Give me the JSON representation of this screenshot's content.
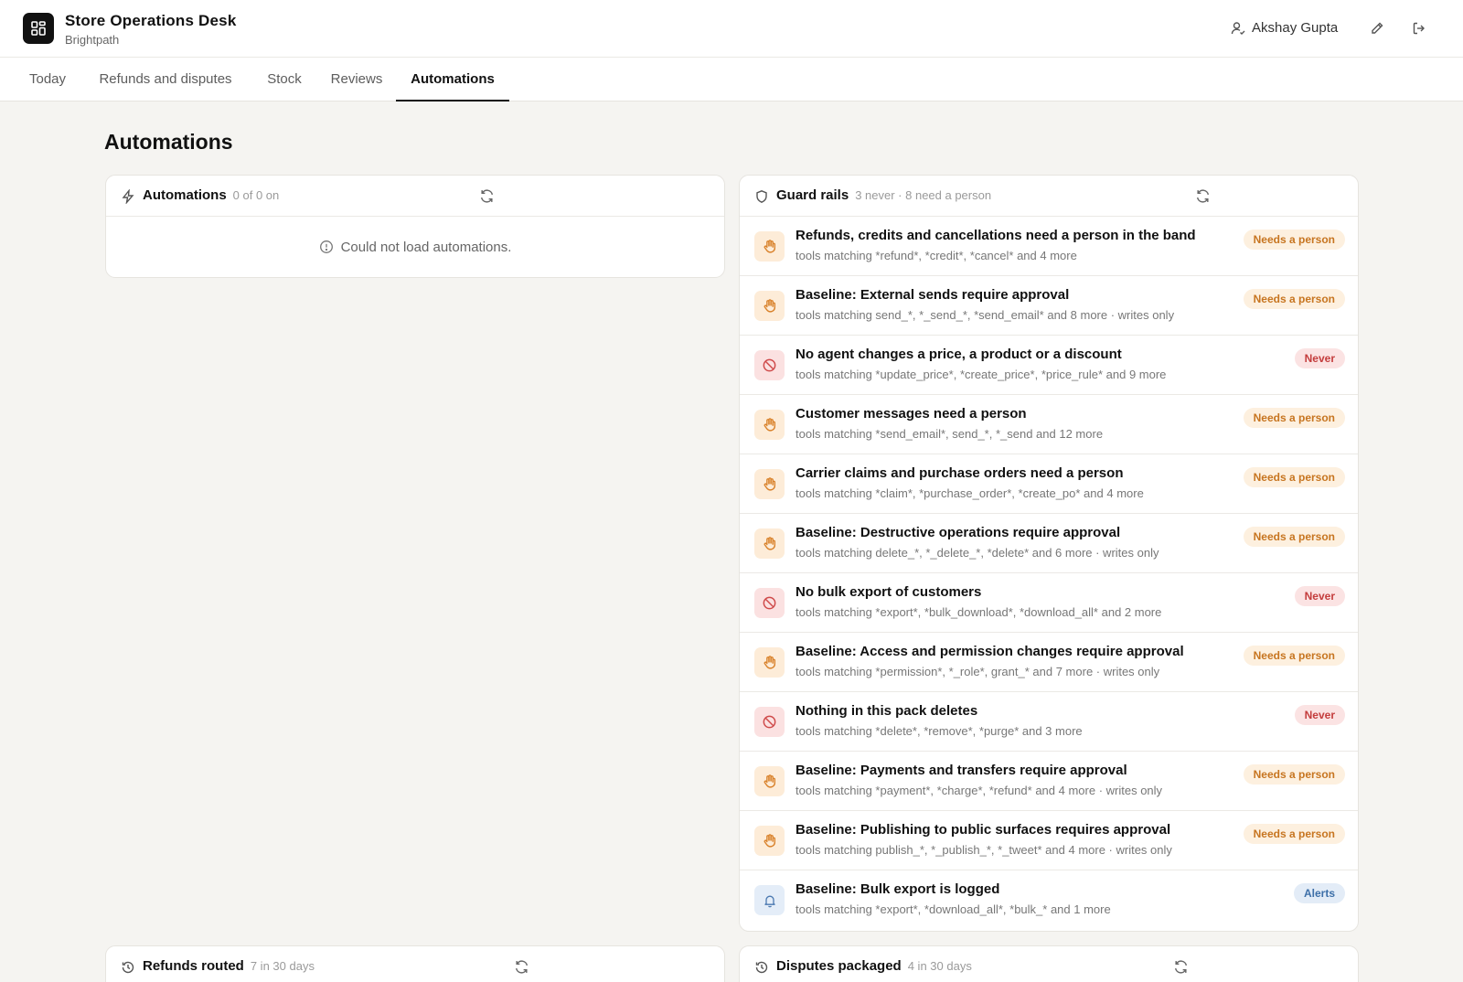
{
  "header": {
    "app_title": "Store Operations Desk",
    "org_name": "Brightpath",
    "user_name": "Akshay Gupta"
  },
  "tabs": [
    {
      "label": "Today"
    },
    {
      "label": "Refunds and disputes"
    },
    {
      "label": "Stock"
    },
    {
      "label": "Reviews"
    },
    {
      "label": "Automations",
      "active": true
    }
  ],
  "page": {
    "title": "Automations"
  },
  "automations_card": {
    "title": "Automations",
    "meta": "0 of 0 on",
    "error": "Could not load automations."
  },
  "guard_rails": {
    "title": "Guard rails",
    "meta": "3 never · 8 need a person",
    "rules": [
      {
        "title": "Refunds, credits and cancellations need a person in the band",
        "desc": "tools matching *refund*, *credit*, *cancel* and 4 more",
        "kind": "person",
        "badge": "Needs a person"
      },
      {
        "title": "Baseline: External sends require approval",
        "desc": "tools matching send_*, *_send_*, *send_email* and 8 more · writes only",
        "kind": "person",
        "badge": "Needs a person"
      },
      {
        "title": "No agent changes a price, a product or a discount",
        "desc": "tools matching *update_price*, *create_price*, *price_rule* and 9 more",
        "kind": "never",
        "badge": "Never"
      },
      {
        "title": "Customer messages need a person",
        "desc": "tools matching *send_email*, send_*, *_send and 12 more",
        "kind": "person",
        "badge": "Needs a person"
      },
      {
        "title": "Carrier claims and purchase orders need a person",
        "desc": "tools matching *claim*, *purchase_order*, *create_po* and 4 more",
        "kind": "person",
        "badge": "Needs a person"
      },
      {
        "title": "Baseline: Destructive operations require approval",
        "desc": "tools matching delete_*, *_delete_*, *delete* and 6 more · writes only",
        "kind": "person",
        "badge": "Needs a person"
      },
      {
        "title": "No bulk export of customers",
        "desc": "tools matching *export*, *bulk_download*, *download_all* and 2 more",
        "kind": "never",
        "badge": "Never"
      },
      {
        "title": "Baseline: Access and permission changes require approval",
        "desc": "tools matching *permission*, *_role*, grant_* and 7 more · writes only",
        "kind": "person",
        "badge": "Needs a person"
      },
      {
        "title": "Nothing in this pack deletes",
        "desc": "tools matching *delete*, *remove*, *purge* and 3 more",
        "kind": "never",
        "badge": "Never"
      },
      {
        "title": "Baseline: Payments and transfers require approval",
        "desc": "tools matching *payment*, *charge*, *refund* and 4 more · writes only",
        "kind": "person",
        "badge": "Needs a person"
      },
      {
        "title": "Baseline: Publishing to public surfaces requires approval",
        "desc": "tools matching publish_*, *_publish_*, *_tweet* and 4 more · writes only",
        "kind": "person",
        "badge": "Needs a person"
      },
      {
        "title": "Baseline: Bulk export is logged",
        "desc": "tools matching *export*, *download_all*, *bulk_* and 1 more",
        "kind": "alert",
        "badge": "Alerts"
      }
    ]
  },
  "refunds_card": {
    "title": "Refunds routed",
    "meta": "7 in 30 days"
  },
  "disputes_card": {
    "title": "Disputes packaged",
    "meta": "4 in 30 days"
  },
  "icons": {
    "logo": "dashboard-grid-icon",
    "user": "user-icon",
    "edit": "pencil-icon",
    "logout": "logout-icon",
    "automations": "lightning-icon",
    "guard_rails": "shield-icon",
    "refresh": "refresh-icon",
    "error": "alert-circle-icon",
    "person_rule": "hand-icon",
    "never_rule": "ban-icon",
    "alert_rule": "bell-icon",
    "history": "history-icon"
  },
  "colors": {
    "person_accent": "#c77520",
    "never_accent": "#c43d3d",
    "alert_accent": "#3d6fa8"
  }
}
